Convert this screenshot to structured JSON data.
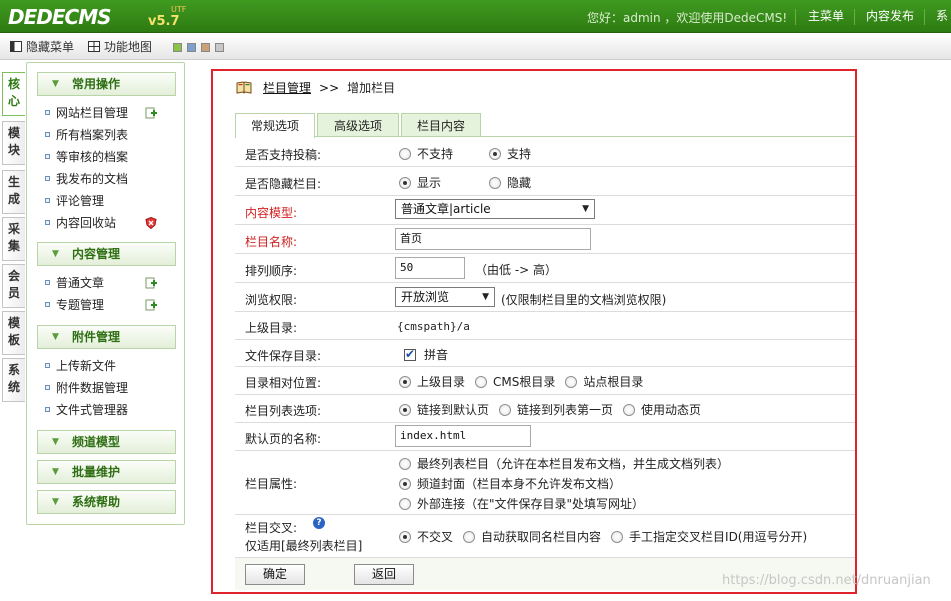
{
  "header": {
    "logo": "DEDECMS",
    "version": "v5.7",
    "version_sup": "UTF",
    "greeting": "您好：admin ，欢迎使用DedeCMS!",
    "nav": [
      "主菜单",
      "内容发布",
      "系"
    ]
  },
  "toolbar": {
    "hide_menu": "隐藏菜单",
    "site_map": "功能地图",
    "theme_swatches": [
      "#8bc34a",
      "#7b9fcf",
      "#c9a27a",
      "#c8c8c8"
    ]
  },
  "vtabs": [
    "核心",
    "模块",
    "生成",
    "采集",
    "会员",
    "模板",
    "系统"
  ],
  "left_menu": {
    "sections": [
      {
        "title": "常用操作",
        "items": [
          "网站栏目管理",
          "所有档案列表",
          "等审核的档案",
          "我发布的文档",
          "评论管理",
          "内容回收站"
        ]
      },
      {
        "title": "内容管理",
        "items": [
          "普通文章",
          "专题管理"
        ]
      },
      {
        "title": "附件管理",
        "items": [
          "上传新文件",
          "附件数据管理",
          "文件式管理器"
        ]
      },
      {
        "title": "频道模型",
        "items": []
      },
      {
        "title": "批量维护",
        "items": []
      },
      {
        "title": "系统帮助",
        "items": []
      }
    ]
  },
  "breadcrumb": {
    "root": "栏目管理",
    "separator": ">>",
    "current": "增加栏目"
  },
  "tabs": [
    "常规选项",
    "高级选项",
    "栏目内容"
  ],
  "form": {
    "allow_submit": {
      "label": "是否支持投稿:",
      "options": [
        "不支持",
        "支持"
      ],
      "selected": 1
    },
    "hide_category": {
      "label": "是否隐藏栏目:",
      "options": [
        "显示",
        "隐藏"
      ],
      "selected": 0
    },
    "content_model": {
      "label": "内容模型:",
      "value": "普通文章|article"
    },
    "category_name": {
      "label": "栏目名称:",
      "value": "首页"
    },
    "sort_order": {
      "label": "排列顺序:",
      "value": "50",
      "note": "（由低 -> 高）"
    },
    "browse_permission": {
      "label": "浏览权限:",
      "value": "开放浏览",
      "note": "(仅限制栏目里的文档浏览权限)"
    },
    "parent_dir": {
      "label": "上级目录:",
      "value": "{cmspath}/a"
    },
    "save_dir": {
      "label": "文件保存目录:",
      "checkbox_label": "拼音",
      "checked": true
    },
    "dir_relative": {
      "label": "目录相对位置:",
      "options": [
        "上级目录",
        "CMS根目录",
        "站点根目录"
      ],
      "selected": 0
    },
    "list_option": {
      "label": "栏目列表选项:",
      "options": [
        "链接到默认页",
        "链接到列表第一页",
        "使用动态页"
      ],
      "selected": 0
    },
    "default_page": {
      "label": "默认页的名称:",
      "value": "index.html"
    },
    "category_attr": {
      "label": "栏目属性:",
      "options": [
        "最终列表栏目（允许在本栏目发布文档，并生成文档列表）",
        "频道封面（栏目本身不允许发布文档）",
        "外部连接（在\"文件保存目录\"处填写网址）"
      ],
      "selected": 1
    },
    "cross": {
      "label": "栏目交叉:",
      "sublabel": "仅适用[最终列表栏目]",
      "options": [
        "不交叉",
        "自动获取同名栏目内容",
        "手工指定交叉栏目ID(用逗号分开)"
      ],
      "selected": 0
    }
  },
  "buttons": {
    "ok": "确定",
    "back": "返回"
  },
  "watermark": "https://blog.csdn.net/dnruanjian"
}
